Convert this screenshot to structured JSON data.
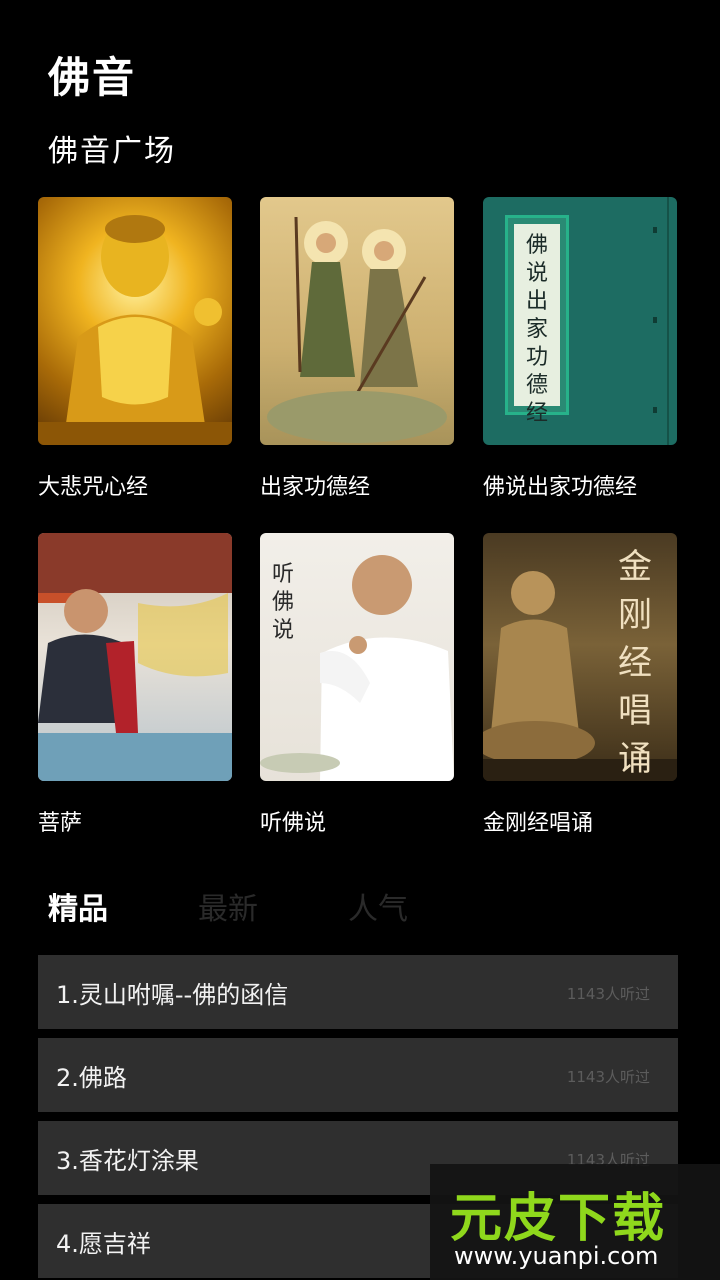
{
  "header": {
    "title": "佛音"
  },
  "plaza": {
    "title": "佛音广场",
    "items": [
      {
        "label": "大悲咒心经"
      },
      {
        "label": "出家功德经"
      },
      {
        "label": "佛说出家功德经",
        "cover_text": "佛说出家功德经"
      },
      {
        "label": "菩萨"
      },
      {
        "label": "听佛说",
        "cover_text": "听佛说"
      },
      {
        "label": "金刚经唱诵",
        "cover_text": "金刚经唱诵"
      }
    ]
  },
  "tabs": [
    {
      "label": "精品",
      "active": true
    },
    {
      "label": "最新",
      "active": false
    },
    {
      "label": "人气",
      "active": false
    }
  ],
  "list": [
    {
      "title": "1.灵山咐嘱--佛的函信",
      "count": "1143人听过"
    },
    {
      "title": "2.佛路",
      "count": "1143人听过"
    },
    {
      "title": "3.香花灯涂果",
      "count": "1143人听过"
    },
    {
      "title": "4.愿吉祥",
      "count": ""
    }
  ],
  "watermark": {
    "brand": "元皮下载",
    "url": "www.yuanpi.com"
  },
  "colors": {
    "background": "#000000",
    "list_item": "#2f2f2f",
    "watermark_green": "#8fd81c"
  }
}
